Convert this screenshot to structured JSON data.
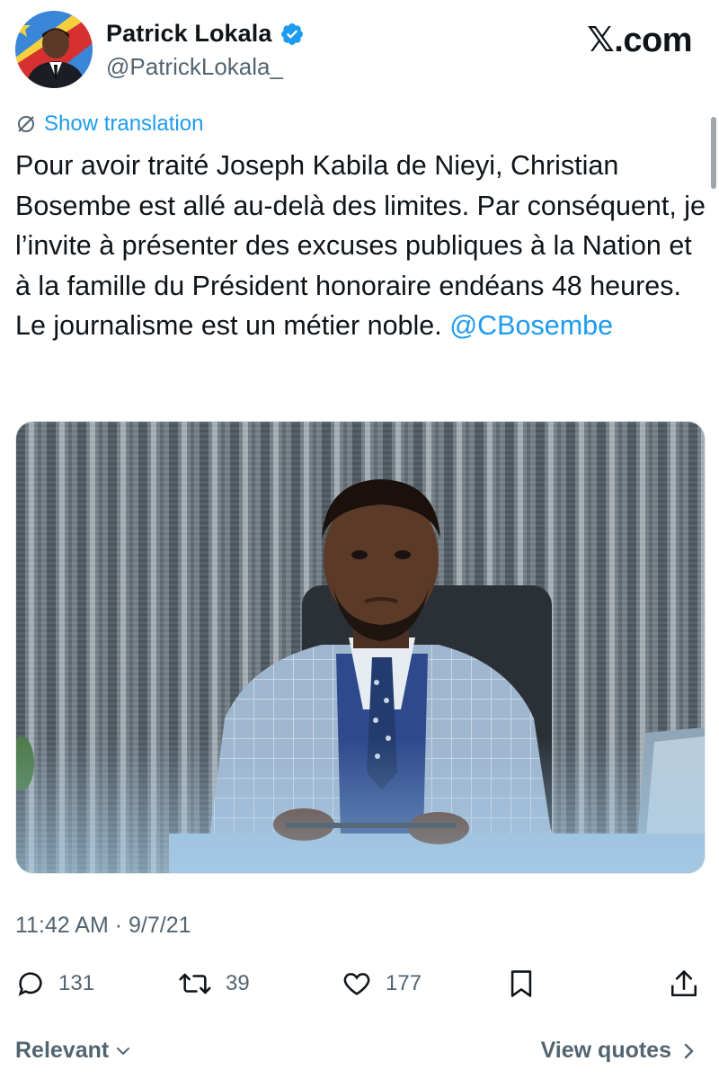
{
  "header": {
    "display_name": "Patrick Lokala",
    "handle": "@PatrickLokala_",
    "brand": "X.com",
    "brand_x": "𝕏",
    "brand_suffix": ".com"
  },
  "translation": {
    "label": "Show translation"
  },
  "tweet": {
    "text": "Pour avoir traité Joseph Kabila de Nieyi, Christian Bosembe est allé au-delà des limites. Par conséquent, je l’invite à présenter des excuses publiques à la Nation et à la famille du Président honoraire endéans 48 heures. Le journalisme est un métier noble. ",
    "mention": "@CBosembe"
  },
  "meta": {
    "timestamp": "11:42 AM · 9/7/21"
  },
  "actions": {
    "replies": "131",
    "reposts": "39",
    "likes": "177"
  },
  "footer": {
    "sort_label": "Relevant",
    "view_quotes": "View quotes"
  },
  "colors": {
    "accent": "#1d9bf0",
    "text": "#0f1419",
    "secondary": "#536471"
  }
}
